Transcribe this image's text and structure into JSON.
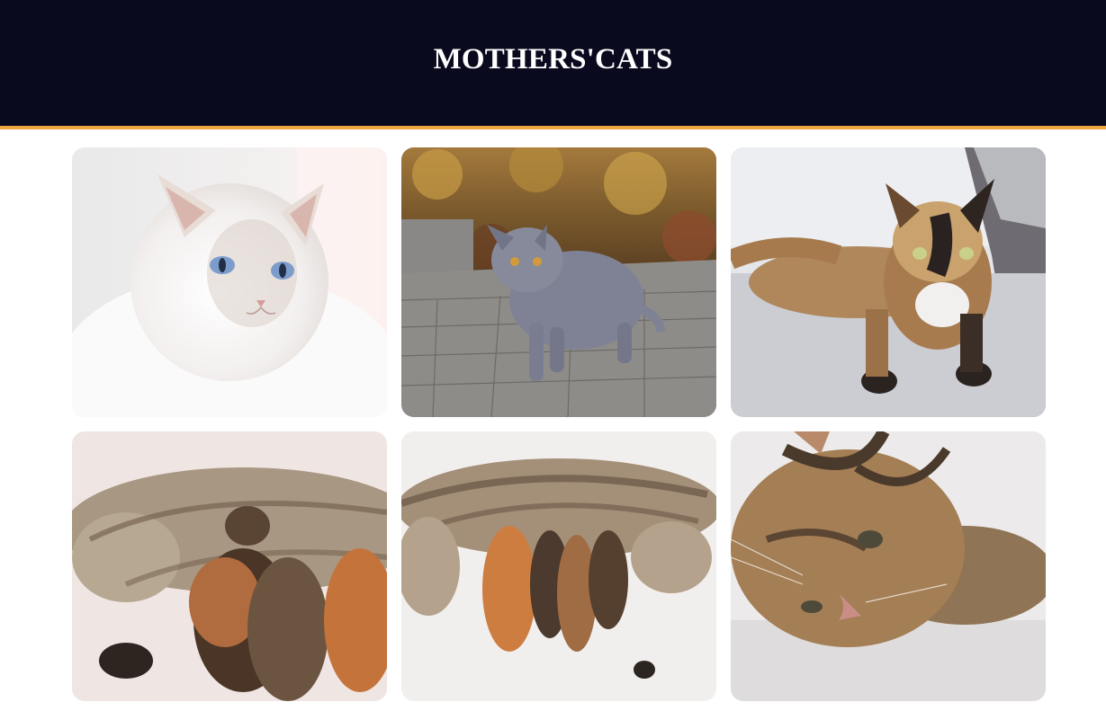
{
  "header": {
    "title": "MOTHERS'CATS",
    "background_color": "#0a0a1f",
    "accent_border_color": "#f0a640"
  },
  "gallery": {
    "photos": [
      {
        "subject": "white-fluffy-blue-eyed-cat"
      },
      {
        "subject": "grey-british-shorthair-on-pavement"
      },
      {
        "subject": "tortoiseshell-cat-lying-on-sofa"
      },
      {
        "subject": "tabby-mother-nursing-kittens"
      },
      {
        "subject": "tabby-mother-with-kittens-on-blanket"
      },
      {
        "subject": "tabby-cat-lying-closeup"
      }
    ]
  }
}
